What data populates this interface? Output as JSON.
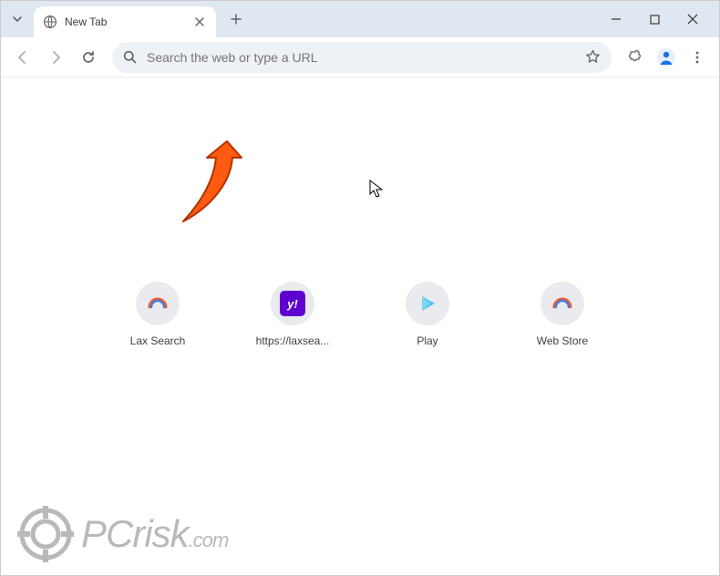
{
  "tab": {
    "title": "New Tab"
  },
  "omnibox": {
    "placeholder": "Search the web or type a URL"
  },
  "shortcuts": [
    {
      "label": "Lax Search",
      "icon": "arc"
    },
    {
      "label": "https://laxsea...",
      "icon": "yahoo"
    },
    {
      "label": "Play",
      "icon": "play"
    },
    {
      "label": "Web Store",
      "icon": "arc"
    }
  ],
  "watermark": {
    "brand": "PCrisk",
    "suffix": ".com"
  }
}
